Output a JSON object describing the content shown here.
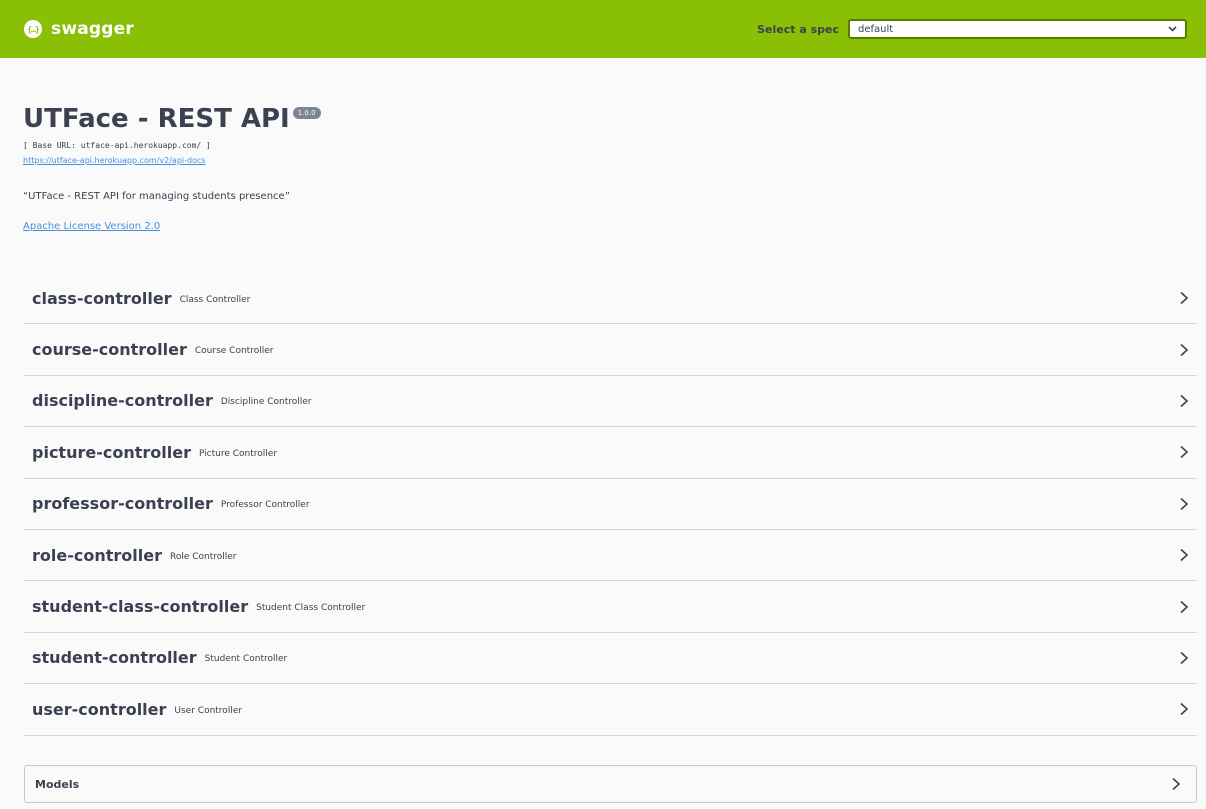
{
  "topbar": {
    "logo_glyph": "{…}",
    "logo_text": "swagger",
    "spec_label": "Select a spec",
    "spec_value": "default"
  },
  "info": {
    "title": "UTFace - REST API",
    "version": "1.0.0",
    "base_url": "[ Base URL: utface-api.herokuapp.com/ ]",
    "api_docs_link": "https://utface-api.herokuapp.com/v2/api-docs",
    "description": "“UTFace - REST API for managing students presence”",
    "license": "Apache License Version 2.0"
  },
  "tags": [
    {
      "name": "class-controller",
      "desc": "Class Controller"
    },
    {
      "name": "course-controller",
      "desc": "Course Controller"
    },
    {
      "name": "discipline-controller",
      "desc": "Discipline Controller"
    },
    {
      "name": "picture-controller",
      "desc": "Picture Controller"
    },
    {
      "name": "professor-controller",
      "desc": "Professor Controller"
    },
    {
      "name": "role-controller",
      "desc": "Role Controller"
    },
    {
      "name": "student-class-controller",
      "desc": "Student Class Controller"
    },
    {
      "name": "student-controller",
      "desc": "Student Controller"
    },
    {
      "name": "user-controller",
      "desc": "User Controller"
    }
  ],
  "models": {
    "label": "Models"
  },
  "colors": {
    "topbar": "#89bf04",
    "text": "#3b4151",
    "link": "#4990e2"
  },
  "icons": {
    "expand": "chevron-right-icon",
    "logo": "swagger-logo-icon",
    "dropdown": "chevron-down-icon"
  }
}
